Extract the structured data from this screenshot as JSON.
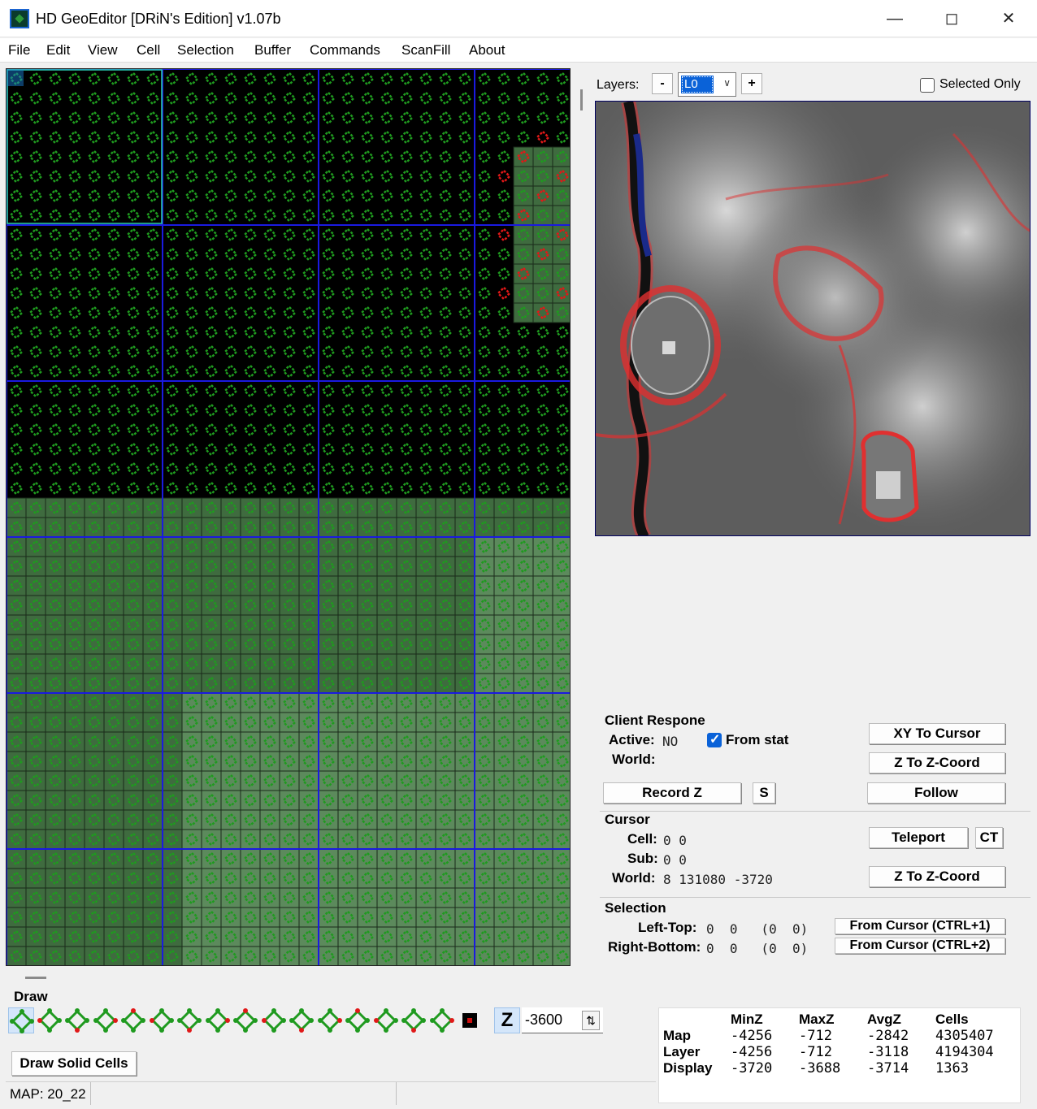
{
  "window": {
    "title": "HD GeoEditor [DRiN's Edition] v1.07b"
  },
  "menu": [
    "File",
    "Edit",
    "View",
    "Cell",
    "Selection",
    "Buffer",
    "Commands",
    "ScanFill",
    "About"
  ],
  "layers": {
    "label": "Layers:",
    "minus": "-",
    "plus": "+",
    "current": "L0",
    "selected_only": "Selected Only",
    "selected_only_checked": false
  },
  "client": {
    "title": "Client Respone",
    "active_label": "Active:",
    "active_value": "NO",
    "from_stat_label": "From stat",
    "from_stat_checked": true,
    "world_label": "World:",
    "xy_to_cursor": "XY To Cursor",
    "z_to_zcoord": "Z To Z-Coord",
    "record_z": "Record Z",
    "s": "S",
    "follow": "Follow"
  },
  "cursor": {
    "title": "Cursor",
    "cell_label": "Cell:",
    "cell_value": "0  0",
    "sub_label": "Sub:",
    "sub_value": "0  0",
    "world_label": "World:",
    "world_value": "8  131080  -3720",
    "teleport": "Teleport",
    "ct": "CT",
    "z_to_zcoord": "Z To Z-Coord"
  },
  "selection": {
    "title": "Selection",
    "left_top_label": "Left-Top:",
    "left_top_value": "0  0   (0  0)",
    "right_bottom_label": "Right-Bottom:",
    "right_bottom_value": "0  0   (0  0)",
    "from_cursor_1": "From Cursor (CTRL+1)",
    "from_cursor_2": "From Cursor (CTRL+2)"
  },
  "draw": {
    "label": "Draw",
    "tool_icons": [
      "diamond-all",
      "diamond",
      "diamond",
      "diamond",
      "diamond",
      "diamond",
      "diamond",
      "diamond",
      "diamond",
      "diamond",
      "diamond",
      "diamond",
      "diamond",
      "diamond",
      "diamond",
      "diamond",
      "solid-block"
    ],
    "z_button": "Z",
    "z_value": "-3600",
    "draw_solid": "Draw Solid Cells"
  },
  "status": {
    "map": "MAP: 20_22"
  },
  "stats": {
    "headers": [
      "MinZ",
      "MaxZ",
      "AvgZ",
      "Cells"
    ],
    "rows": [
      {
        "name": "Map",
        "values": [
          "-4256",
          "-712",
          "-2842",
          "4305407"
        ]
      },
      {
        "name": "Layer",
        "values": [
          "-4256",
          "-712",
          "-3118",
          "4194304"
        ]
      },
      {
        "name": "Display",
        "values": [
          "-3720",
          "-3688",
          "-3714",
          "1363"
        ]
      }
    ]
  },
  "colors": {
    "accent": "#0a62d8",
    "grid_cell_green": "#1f9a1f",
    "grid_block_blue": "#1a1ae0",
    "grid_bg": "#000000",
    "cell_fill": "#3f6b3f",
    "edge_red": "#e01818"
  }
}
